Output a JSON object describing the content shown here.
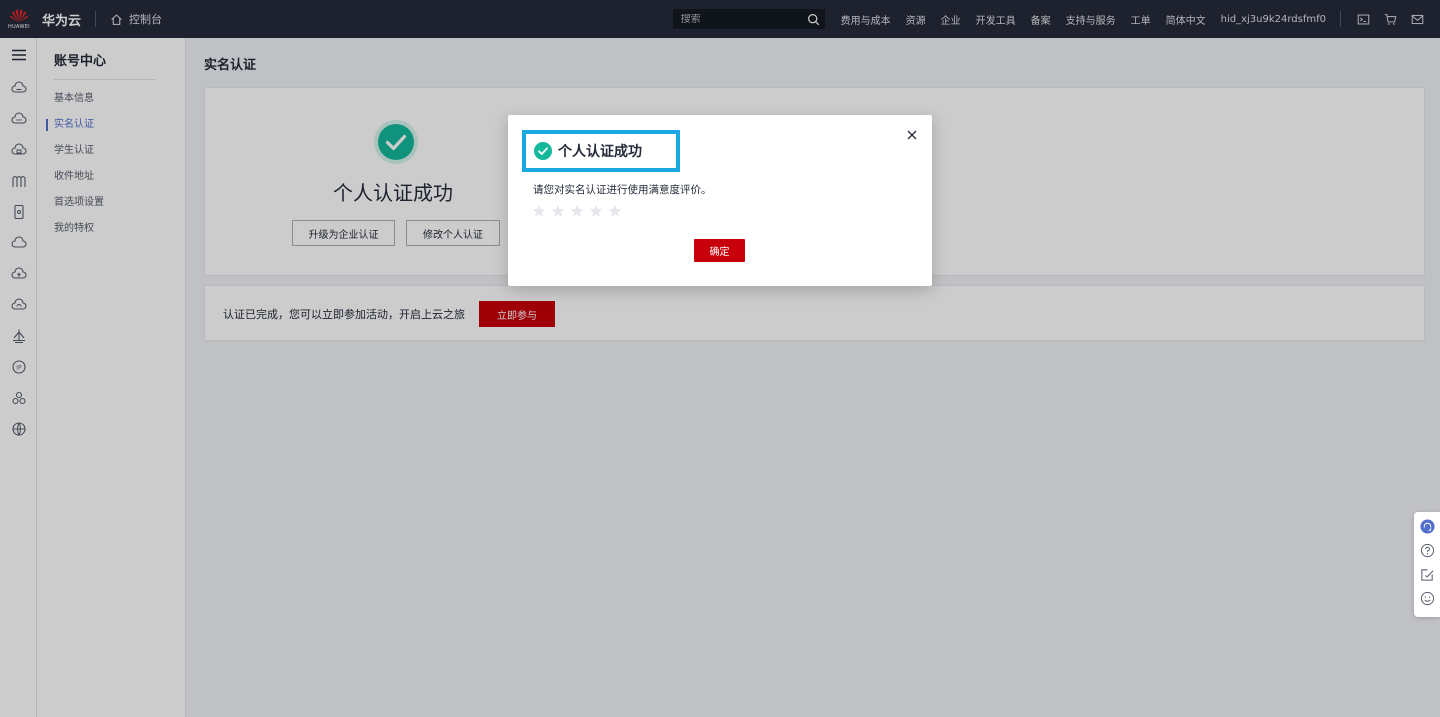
{
  "topbar": {
    "logo_text": "HUAWEI",
    "brand": "华为云",
    "console_label": "控制台",
    "search_placeholder": "搜索",
    "nav_items": [
      "费用与成本",
      "资源",
      "企业",
      "开发工具",
      "备案",
      "支持与服务",
      "工单",
      "简体中文"
    ],
    "user_id": "hid_xj3u9k24rdsfmf0"
  },
  "sidemenu": {
    "title": "账号中心",
    "items": [
      "基本信息",
      "实名认证",
      "学生认证",
      "收件地址",
      "首选项设置",
      "我的特权"
    ],
    "active_index": 1
  },
  "main": {
    "page_title": "实名认证",
    "success_title": "个人认证成功",
    "upgrade_button": "升级为企业认证",
    "modify_button": "修改个人认证",
    "notice_text": "认证已完成，您可以立即参加活动，开启上云之旅",
    "join_button": "立即参与"
  },
  "dialog": {
    "title": "个人认证成功",
    "body": "请您对实名认证进行使用满意度评价。",
    "rating": 0,
    "rating_max": 5,
    "confirm_button": "确定"
  },
  "colors": {
    "topbar_bg": "#252b3a",
    "brand_red": "#c7000b",
    "success_green": "#14b89c",
    "highlight_blue": "#1aa7e2",
    "active_blue": "#526ecc"
  },
  "icons": {
    "rail": [
      "menu-icon",
      "cloud-server-icon",
      "cloud-icon",
      "cloud-database-icon",
      "arch-icon",
      "phone-icon",
      "cloud-outline-icon",
      "cloud-up-icon",
      "cloud-sync-icon",
      "vessel-icon",
      "ip-icon",
      "cluster-icon",
      "globe-icon"
    ],
    "float": [
      "customer-service-icon",
      "help-icon",
      "feedback-icon",
      "smile-icon"
    ]
  }
}
